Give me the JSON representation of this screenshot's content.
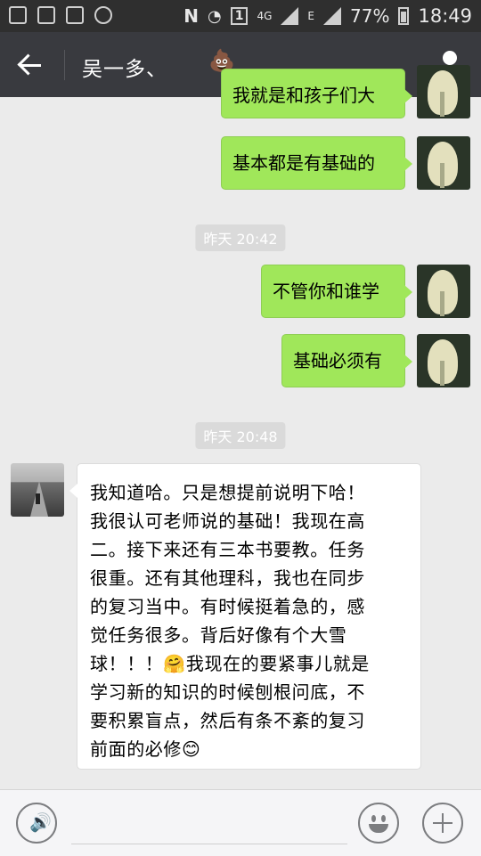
{
  "status_bar": {
    "network": "4G",
    "data_indicator": "E",
    "sim_slot": "1",
    "battery": "77%",
    "time": "18:49"
  },
  "header": {
    "title": "吴一多、",
    "title_emoji": "💩"
  },
  "messages": [
    {
      "type": "sent",
      "text": "我就是和孩子们大"
    },
    {
      "type": "sent",
      "text": "基本都是有基础的"
    },
    {
      "type": "time",
      "text": "昨天 20:42"
    },
    {
      "type": "sent",
      "text": "不管你和谁学"
    },
    {
      "type": "sent",
      "text": "基础必须有"
    },
    {
      "type": "time",
      "text": "昨天 20:48"
    },
    {
      "type": "received",
      "lines": [
        "我知道哈。只是想提前说明下哈！",
        "我很认可老师说的基础！我现在高",
        "二。接下来还有三本书要教。任务",
        "很重。还有其他理科，我也在同步",
        "的复习当中。有时候挺着急的，感",
        "觉任务很多。背后好像有个大雪",
        "球！！！🤗我现在的要紧事儿就是",
        "学习新的知识的时候刨根问底，不",
        "要积累盲点，然后有条不紊的复习",
        "前面的必修😊"
      ]
    }
  ]
}
